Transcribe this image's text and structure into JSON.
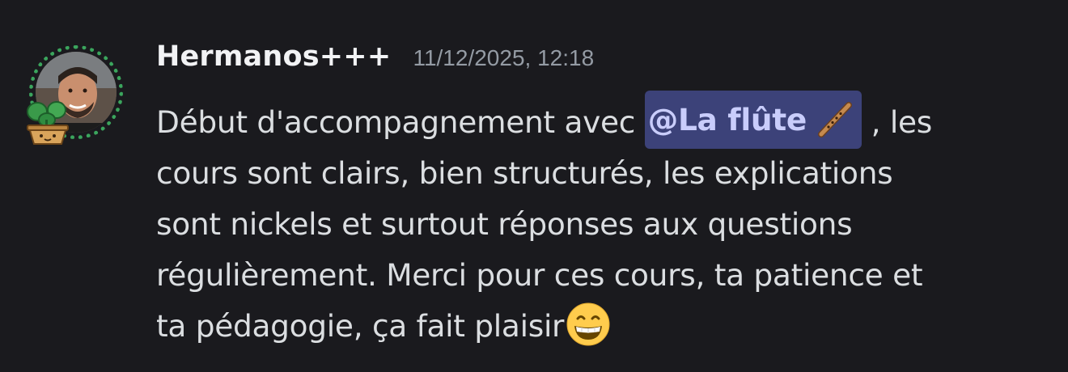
{
  "message": {
    "author": "Hermanos+++",
    "timestamp": "11/12/2025, 12:18",
    "avatar": "user-avatar-photo",
    "avatar_decoration": "potted-plant-decoration",
    "mention": {
      "text": "@La flûte",
      "icon": "flute-icon"
    },
    "content": {
      "line1_before": "Début d'accompagnement avec ",
      "line1_after": " , les",
      "line2": "cours sont clairs, bien structurés, les explications",
      "line3": "sont nickels et surtout réponses aux questions",
      "line4": "régulièrement. Merci pour ces cours, ta patience et",
      "line5": "ta pédagogie, ça fait plaisir"
    },
    "emoji": "grinning-face-emoji"
  },
  "colors": {
    "background": "#1a1a1e",
    "username": "#f2f3f5",
    "timestamp": "#949ba4",
    "text": "#dbdee1",
    "mention_bg": "#3c4279",
    "mention_text": "#c9cdfb",
    "avatar_ring": "#3ba55d"
  }
}
